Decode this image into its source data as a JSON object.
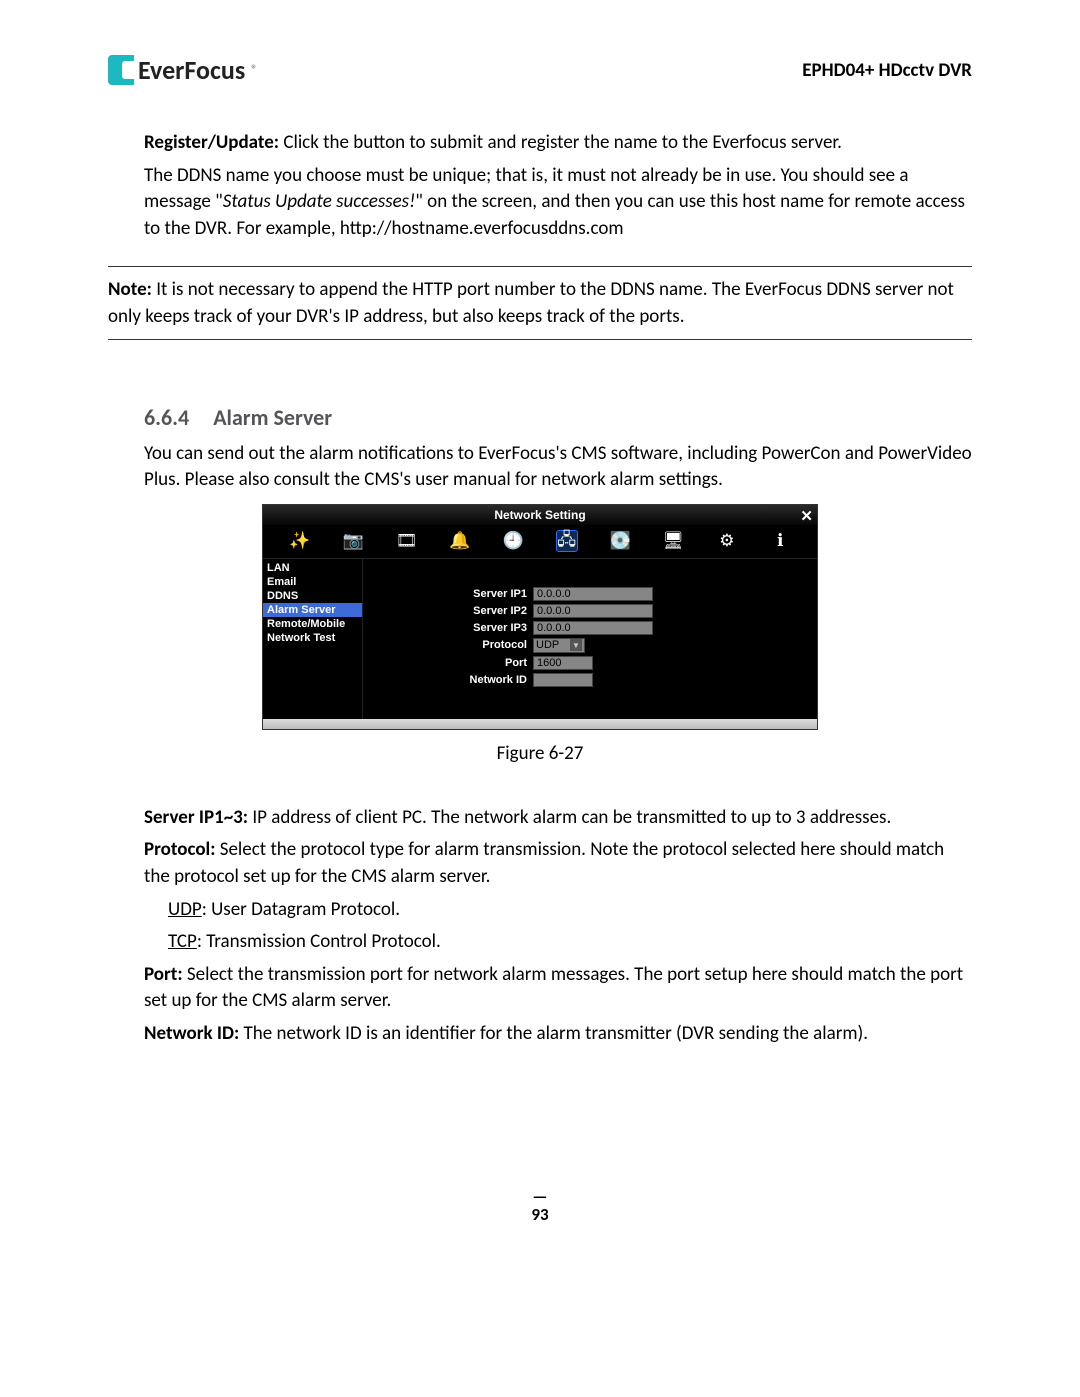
{
  "header": {
    "brand": "EverFocus",
    "product": "EPHD04+  HDcctv DVR"
  },
  "para_register": {
    "label": "Register/Update:",
    "text": " Click the button to submit and register the name to the Everfocus server."
  },
  "para_ddns_1": "The DDNS name you choose must be unique; that is, it must not already be in use. You should see a message \"",
  "para_ddns_italic": "Status Update successes!",
  "para_ddns_2": "\" on the screen, and then you can use this host name for remote access to the DVR. For example, http://hostname.everfocusddns.com",
  "note": {
    "label": "Note:",
    "text": " It is not necessary to append the HTTP port number to the DDNS name. The EverFocus DDNS server not only keeps track of your DVR's IP address, but also keeps track of the ports."
  },
  "section": {
    "num": "6.6.4",
    "title": "Alarm Server",
    "intro": "You can send out the alarm notifications to EverFocus's CMS software, including PowerCon and PowerVideo Plus. Please also consult the CMS's user manual for network alarm settings."
  },
  "dvr": {
    "title": "Network Setting",
    "toolbar_icons": [
      {
        "name": "wizard-icon",
        "glyph": "✨"
      },
      {
        "name": "camera-icon",
        "glyph": "📷"
      },
      {
        "name": "record-icon",
        "glyph": "🎞"
      },
      {
        "name": "alarm-icon",
        "glyph": "🔔"
      },
      {
        "name": "schedule-icon",
        "glyph": "🕘"
      },
      {
        "name": "network-icon",
        "glyph": "🖧",
        "selected": true
      },
      {
        "name": "disk-icon",
        "glyph": "💽"
      },
      {
        "name": "display-icon",
        "glyph": "🖥"
      },
      {
        "name": "system-icon",
        "glyph": "⚙"
      },
      {
        "name": "info-icon",
        "glyph": "ℹ"
      }
    ],
    "sidebar": [
      "LAN",
      "Email",
      "DDNS",
      "Alarm Server",
      "Remote/Mobile",
      "Network Test"
    ],
    "sidebar_selected": "Alarm Server",
    "fields": {
      "server_ip1": {
        "label": "Server IP1",
        "value": "0.0.0.0"
      },
      "server_ip2": {
        "label": "Server IP2",
        "value": "0.0.0.0"
      },
      "server_ip3": {
        "label": "Server IP3",
        "value": "0.0.0.0"
      },
      "protocol": {
        "label": "Protocol",
        "value": "UDP"
      },
      "port": {
        "label": "Port",
        "value": "1600"
      },
      "network_id": {
        "label": "Network ID",
        "value": ""
      }
    }
  },
  "figure_caption": "Figure 6-27",
  "defs": {
    "server_ip": {
      "label": "Server IP1~3:",
      "text": " IP address of client PC. The network alarm can be transmitted to up to 3 addresses."
    },
    "protocol": {
      "label": "Protocol:",
      "text": " Select the protocol type for alarm transmission. Note the protocol selected here should match the protocol set up for the CMS alarm server."
    },
    "udp": {
      "label": "UDP",
      "text": ": User Datagram Protocol."
    },
    "tcp": {
      "label": "TCP",
      "text": ": Transmission Control Protocol."
    },
    "port": {
      "label": "Port:",
      "text": " Select the transmission port for network alarm messages. The port setup here should match the port set up for the CMS alarm server."
    },
    "network_id": {
      "label": "Network ID:",
      "text": " The network ID is an identifier for the alarm transmitter (DVR sending the alarm)."
    }
  },
  "page_number": "93"
}
